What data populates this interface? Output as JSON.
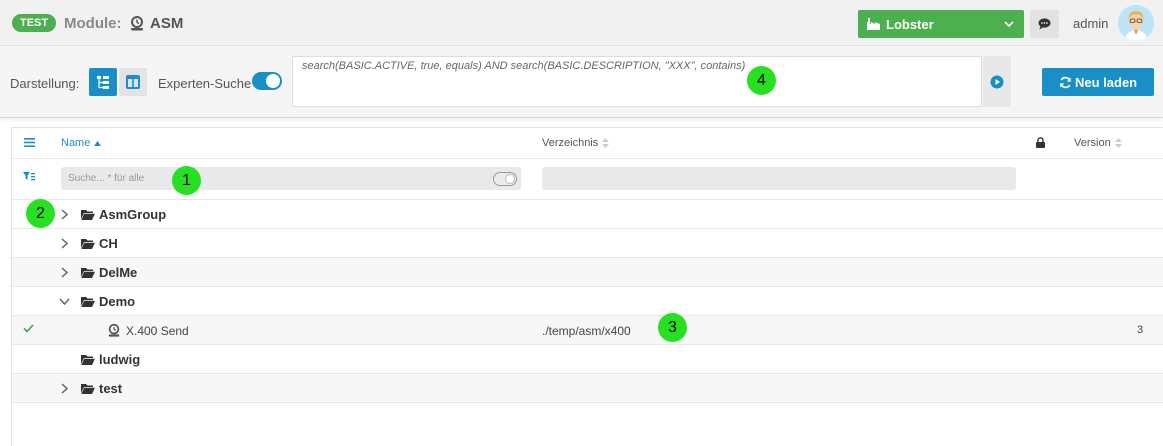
{
  "header": {
    "env_badge": "TEST",
    "module_label": "Module:",
    "module_name": "ASM",
    "tenant": "Lobster",
    "user": "admin"
  },
  "toolbar": {
    "view_label": "Darstellung:",
    "expert_label": "Experten-Suche",
    "expert_query": "search(BASIC.ACTIVE, true, equals) AND search(BASIC.DESCRIPTION, \"XXX\", contains)",
    "reload_label": "Neu laden"
  },
  "grid": {
    "columns": {
      "name": "Name",
      "directory": "Verzeichnis",
      "version": "Version"
    },
    "search_placeholder": "Suche... * für alle",
    "rows": [
      {
        "label": "AsmGroup",
        "expanded": false
      },
      {
        "label": "CH",
        "expanded": false
      },
      {
        "label": "DelMe",
        "expanded": false
      },
      {
        "label": "Demo",
        "expanded": true
      },
      {
        "label": "X.400 Send",
        "directory": "./temp/asm/x400",
        "version": "3"
      },
      {
        "label": "ludwig"
      },
      {
        "label": "test",
        "expanded": false
      }
    ]
  },
  "callouts": [
    "1",
    "2",
    "3",
    "4"
  ],
  "colors": {
    "accent": "#1a8fc7",
    "green": "#4caf50",
    "callout": "#28e022"
  }
}
